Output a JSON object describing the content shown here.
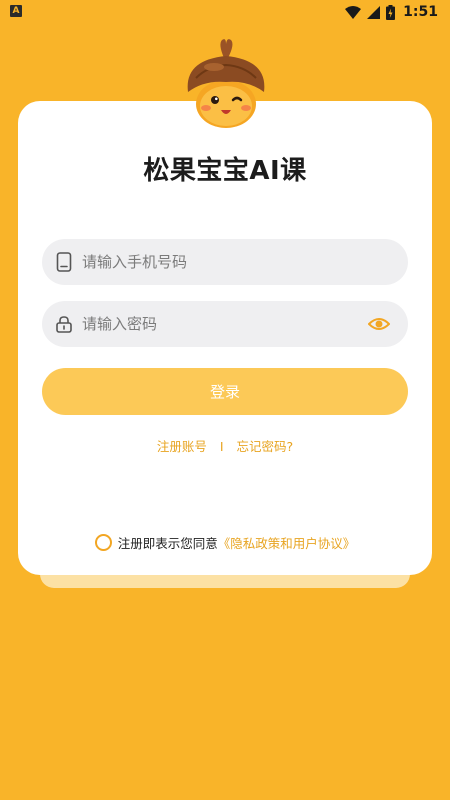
{
  "status_bar": {
    "left_icon_label": "A",
    "time": "1:51"
  },
  "app": {
    "title": "松果宝宝AI课"
  },
  "form": {
    "phone_placeholder": "请输入手机号码",
    "password_placeholder": "请输入密码",
    "login_label": "登录"
  },
  "links": {
    "register": "注册账号",
    "separator": "I",
    "forgot": "忘记密码?"
  },
  "agreement": {
    "text": "注册即表示您同意",
    "policy": "《隐私政策和用户协议》"
  },
  "colors": {
    "background": "#F9B429",
    "accent": "#E8A421",
    "button": "#FCC957",
    "card": "#FFFFFF",
    "input_bg": "#EFEFF1"
  },
  "icons": {
    "status": [
      "wifi-icon",
      "signal-icon",
      "battery-icon"
    ],
    "phone_field": "phone-icon",
    "password_field": "lock-icon",
    "password_toggle": "eye-icon",
    "mascot": "pinecone-mascot"
  }
}
